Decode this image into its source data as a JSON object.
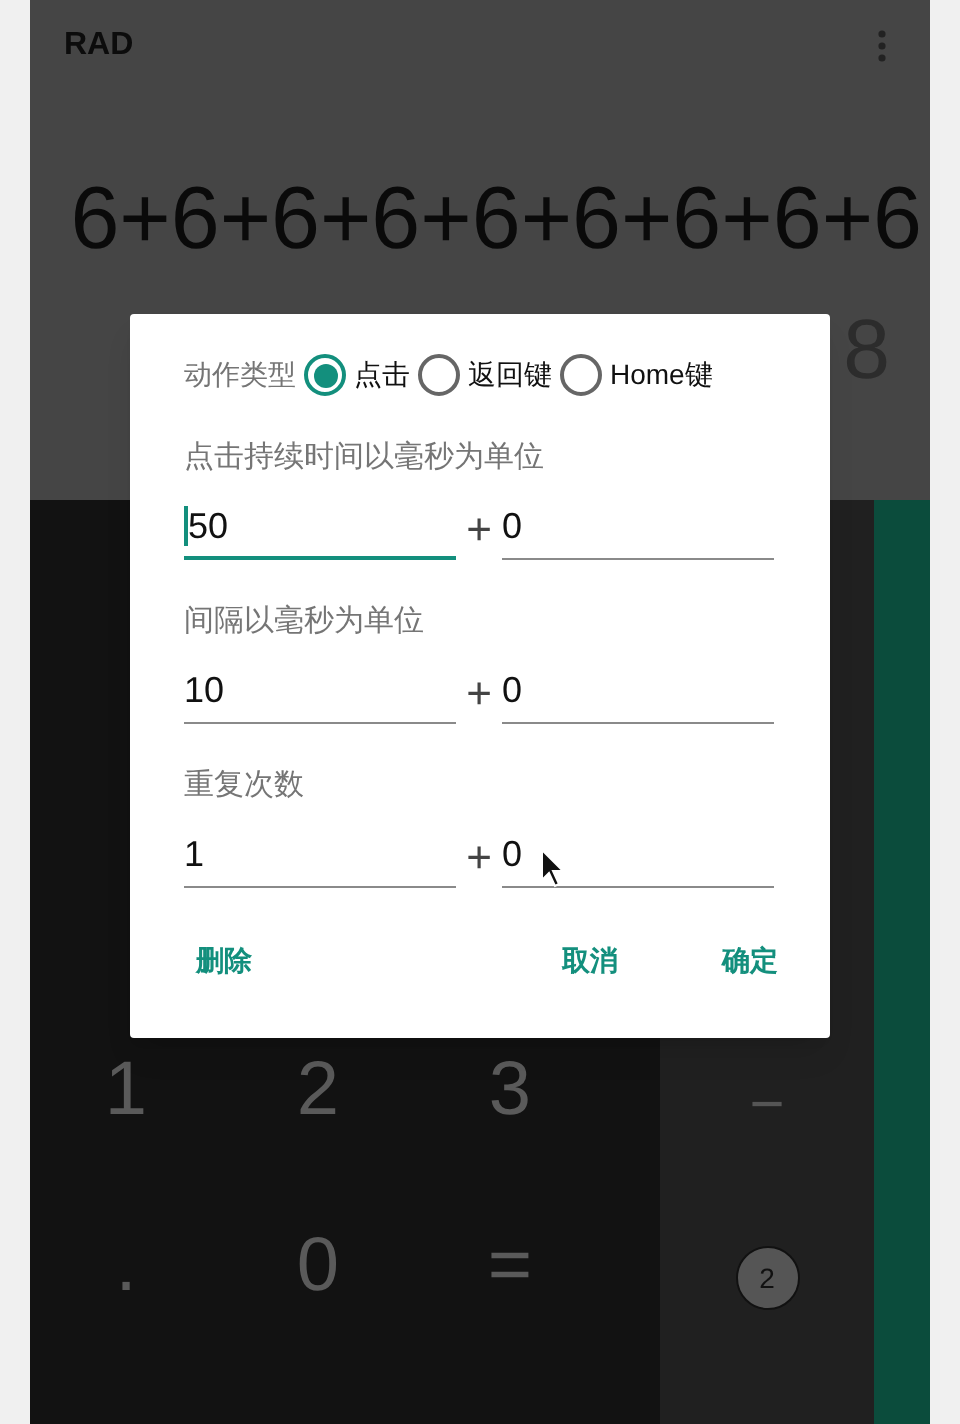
{
  "app_bar": {
    "mode": "RAD"
  },
  "display": {
    "expression": "6+6+6+6+6+6+6+6+6",
    "result": "8"
  },
  "keypad": {
    "rows": [
      [
        "1",
        "2",
        "3"
      ],
      [
        ".",
        "0",
        "="
      ]
    ],
    "operators": [
      "−"
    ],
    "badge": "2"
  },
  "dialog": {
    "action_type": {
      "label": "动作类型",
      "options": [
        {
          "label": "点击",
          "selected": true
        },
        {
          "label": "返回键",
          "selected": false
        },
        {
          "label": "Home键",
          "selected": false
        }
      ]
    },
    "fields": [
      {
        "label": "点击持续时间以毫秒为单位",
        "value": "50",
        "plus": "+",
        "extra": "0",
        "focused": true
      },
      {
        "label": "间隔以毫秒为单位",
        "value": "10",
        "plus": "+",
        "extra": "0",
        "focused": false
      },
      {
        "label": "重复次数",
        "value": "1",
        "plus": "+",
        "extra": "0",
        "focused": false
      }
    ],
    "buttons": [
      {
        "label": "删除",
        "kind": "left"
      },
      {
        "label": "取消",
        "kind": "right"
      },
      {
        "label": "确定",
        "kind": "right"
      }
    ]
  }
}
